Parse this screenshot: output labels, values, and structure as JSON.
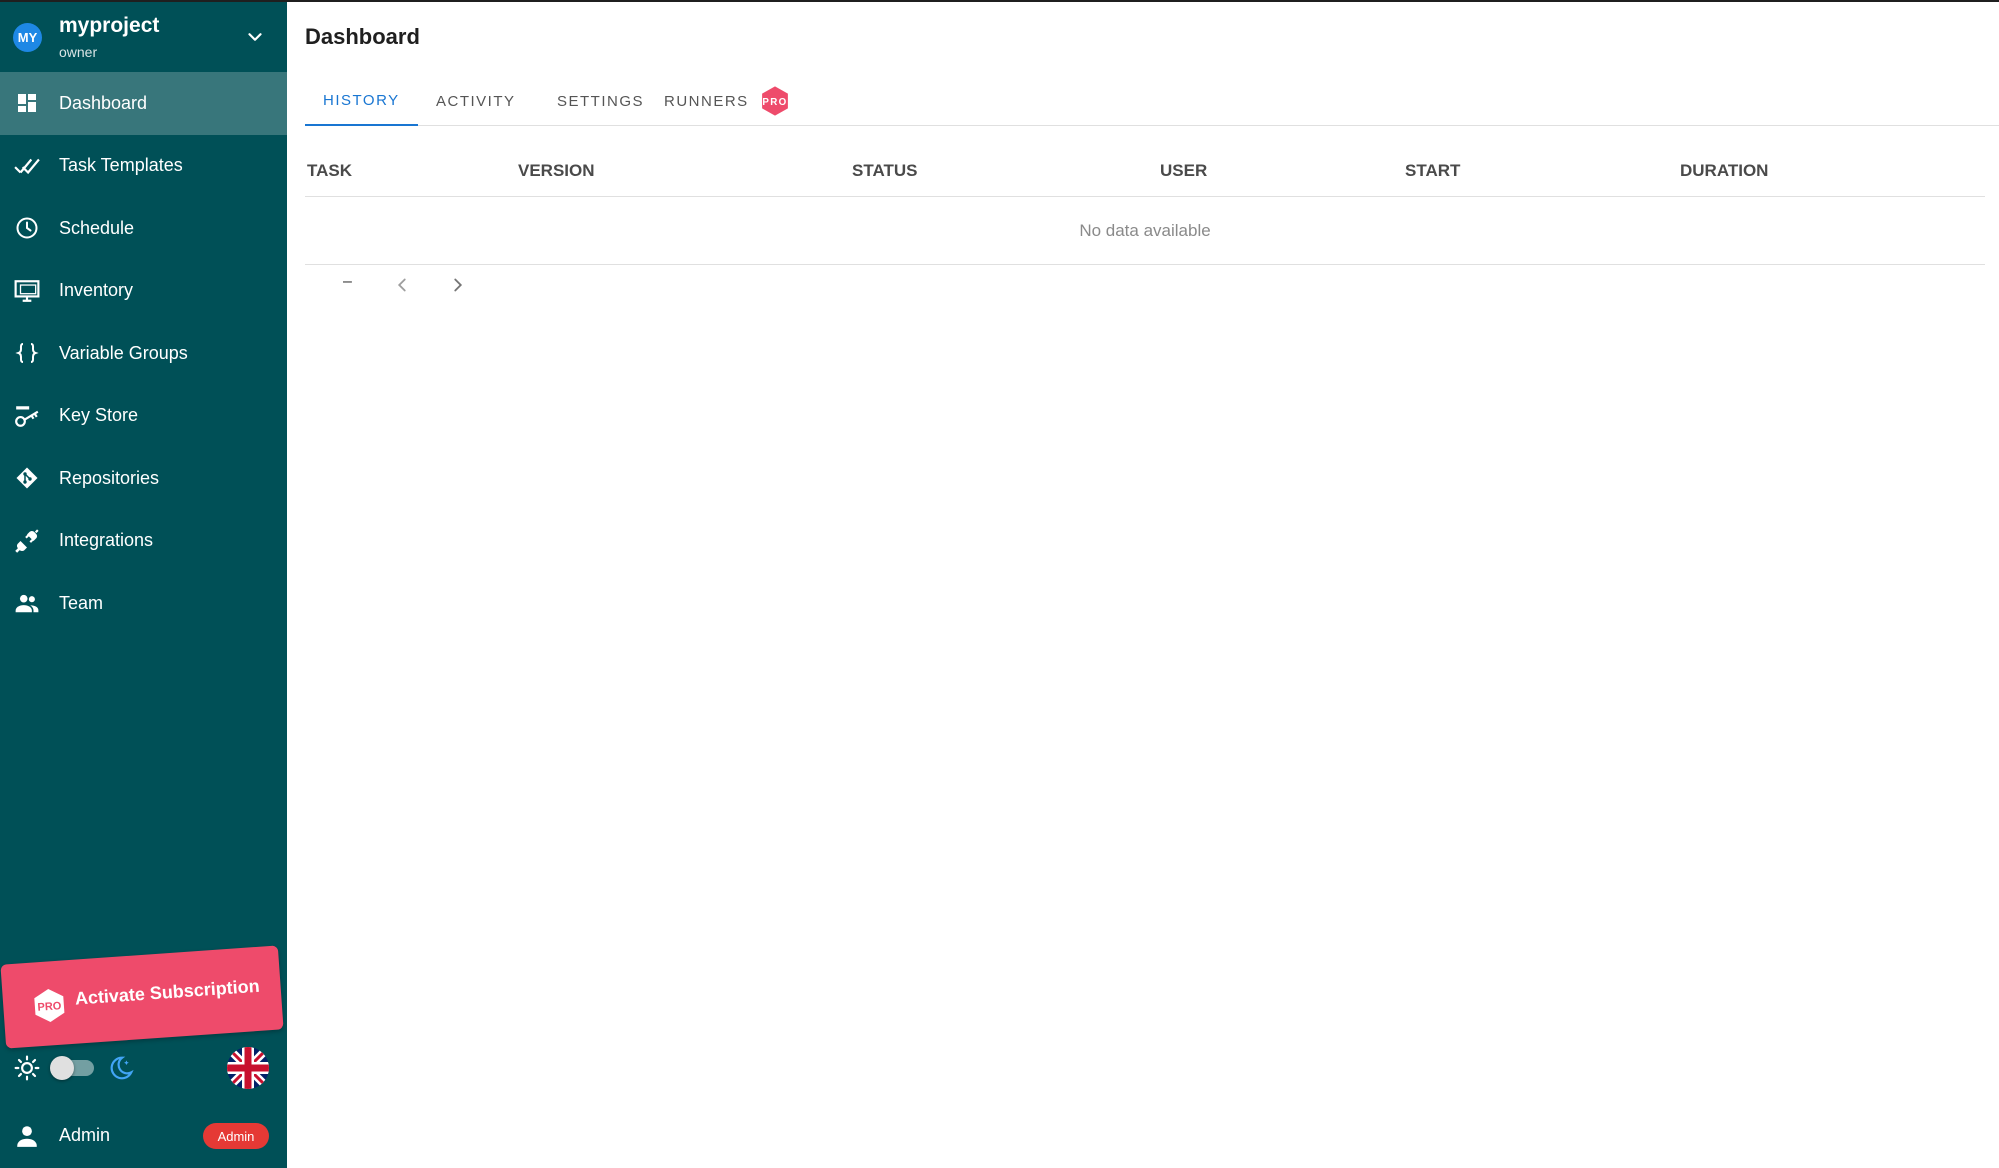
{
  "project": {
    "avatar": "MY",
    "name": "myproject",
    "role": "owner"
  },
  "sidebar": {
    "items": [
      {
        "label": "Dashboard",
        "icon": "dashboard-icon",
        "active": true
      },
      {
        "label": "Task Templates",
        "icon": "done-all-icon"
      },
      {
        "label": "Schedule",
        "icon": "clock-icon"
      },
      {
        "label": "Inventory",
        "icon": "monitor-icon"
      },
      {
        "label": "Variable Groups",
        "icon": "code-braces-icon"
      },
      {
        "label": "Key Store",
        "icon": "key-icon"
      },
      {
        "label": "Repositories",
        "icon": "git-icon"
      },
      {
        "label": "Integrations",
        "icon": "plug-icon"
      },
      {
        "label": "Team",
        "icon": "people-icon"
      }
    ],
    "activate": {
      "pro_label": "PRO",
      "label": "Activate Subscription"
    },
    "user": {
      "name": "Admin",
      "badge": "Admin"
    }
  },
  "main": {
    "title": "Dashboard",
    "tabs": [
      {
        "label": "History",
        "active": true
      },
      {
        "label": "Activity"
      },
      {
        "label": "Settings"
      },
      {
        "label": "Runners",
        "badge": "PRO"
      }
    ],
    "table": {
      "columns": [
        "Task",
        "Version",
        "Status",
        "User",
        "Start",
        "Duration"
      ],
      "empty_text": "No data available"
    },
    "pager": {
      "range": "–"
    }
  },
  "colors": {
    "sidebar": "#005057",
    "accent": "#1976d2",
    "pro": "#ee4b6b",
    "badge": "#e53935"
  }
}
